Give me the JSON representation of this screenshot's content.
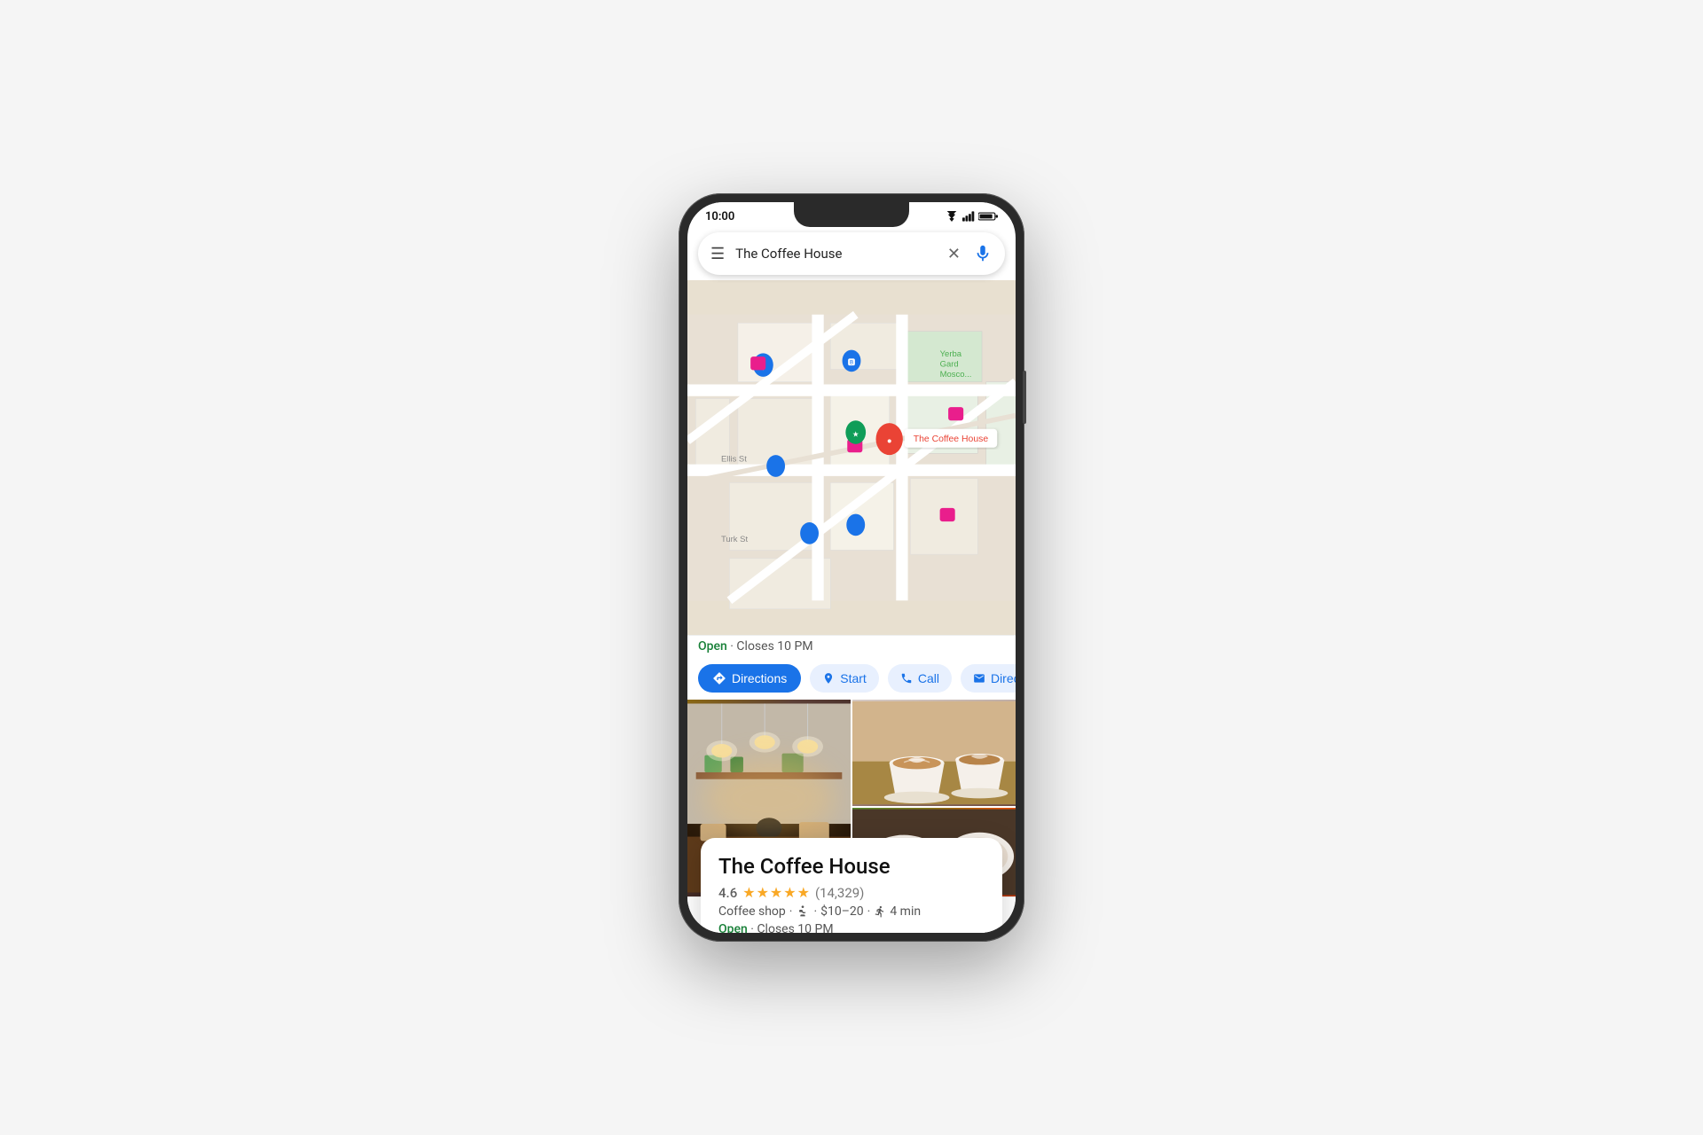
{
  "phone": {
    "status_bar": {
      "time": "10:00"
    },
    "search": {
      "placeholder": "The Coffee House",
      "menu_label": "☰",
      "clear_label": "✕",
      "mic_label": "🎤"
    },
    "map": {
      "marker_label": "The Coffee House"
    },
    "info_card": {
      "title": "The Coffee House",
      "rating_number": "4.6",
      "review_count": "(14,329)",
      "category": "Coffee shop",
      "price_range": "$10–20",
      "walk_time": "4 min",
      "status_open": "Open",
      "status_close": "Closes 10 PM"
    },
    "actions": {
      "directions_label": "Directions",
      "start_label": "Start",
      "call_label": "Call",
      "direct_label": "Direct"
    },
    "bottom_nav": {
      "explore": "⊞",
      "commute": "⬛",
      "saved": "🔖",
      "contribute": "✚"
    }
  }
}
